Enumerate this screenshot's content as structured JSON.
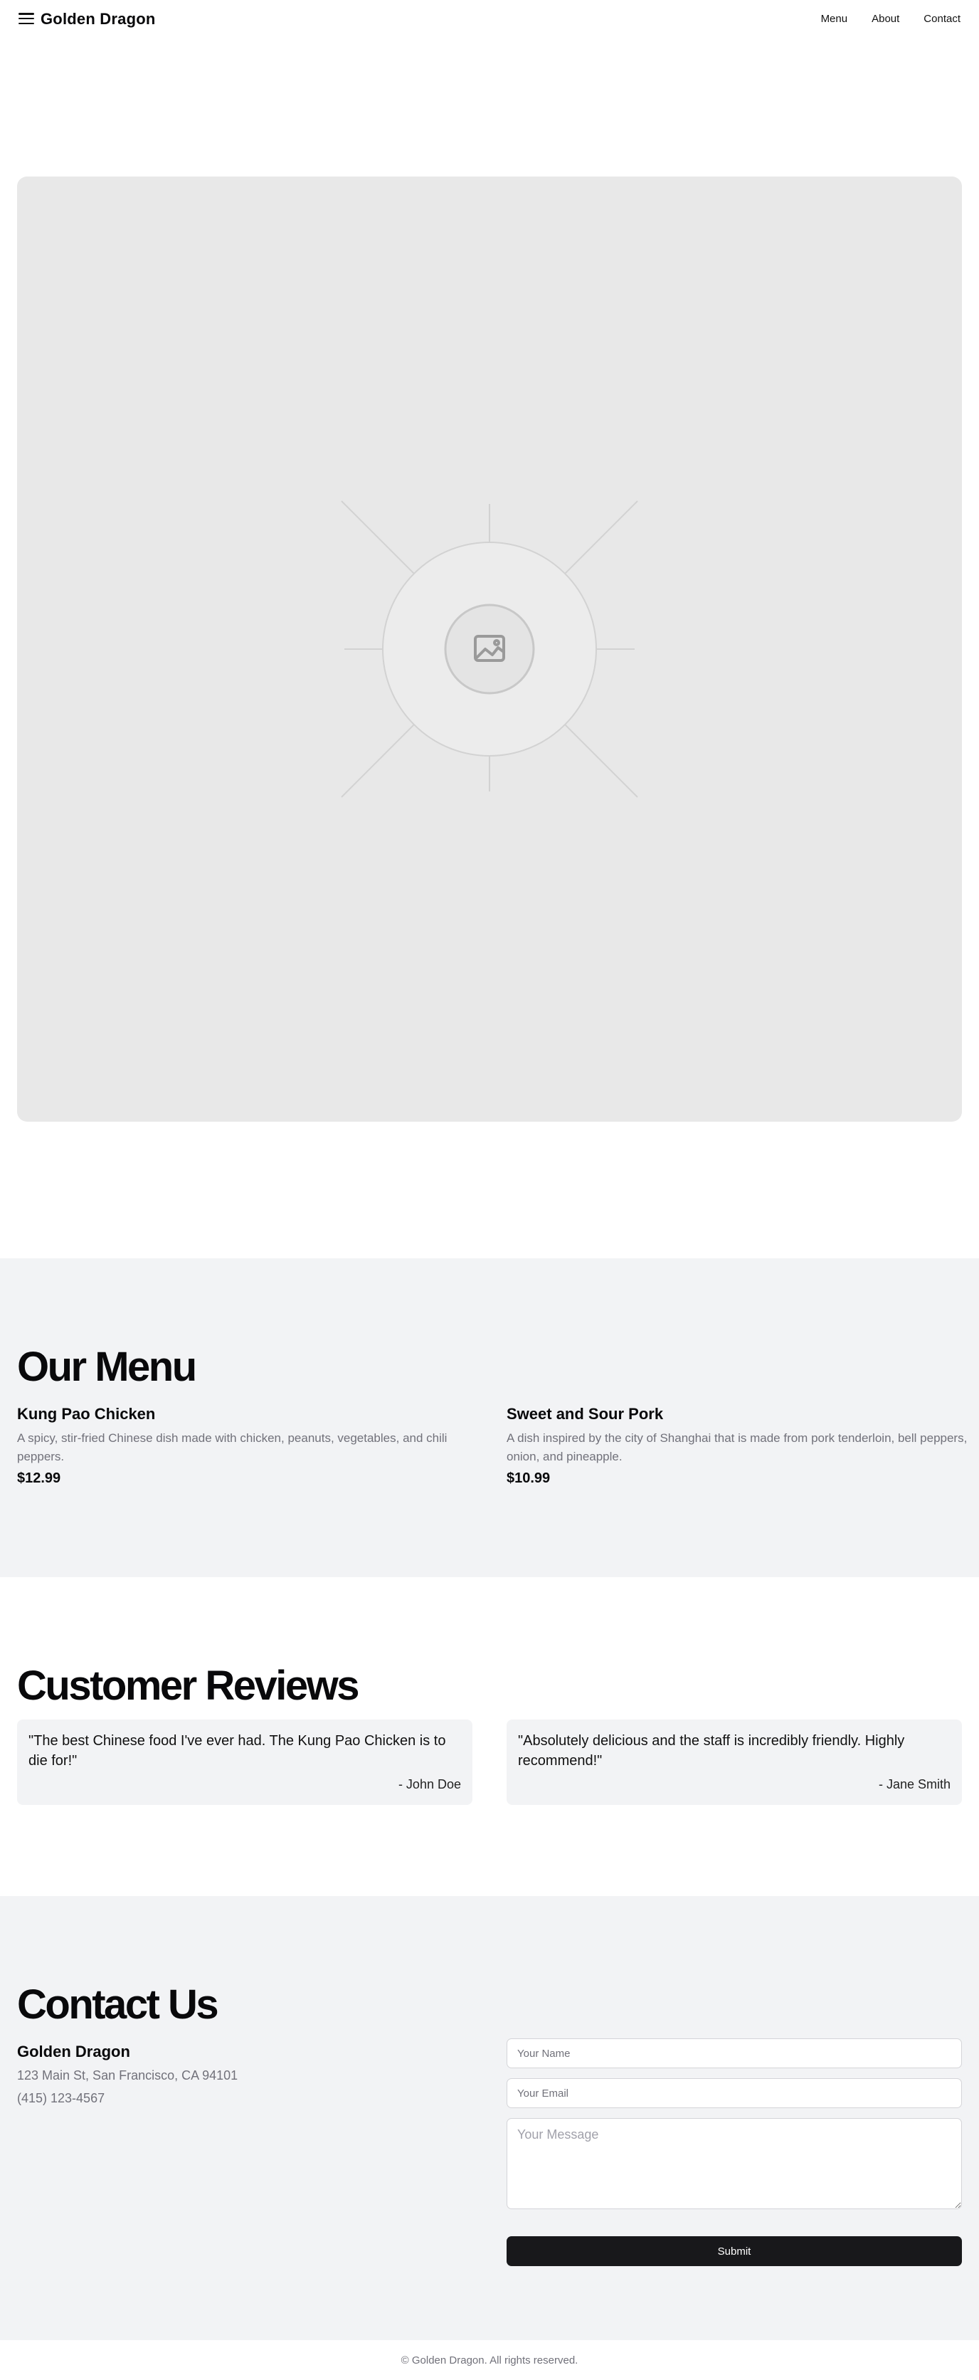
{
  "header": {
    "brand": "Golden Dragon",
    "nav": [
      "Menu",
      "About",
      "Contact"
    ]
  },
  "hero": {
    "image_icon": "image-placeholder-icon"
  },
  "menu_section": {
    "title": "Our Menu",
    "items": [
      {
        "name": "Kung Pao Chicken",
        "description": "A spicy, stir-fried Chinese dish made with chicken, peanuts, vegetables, and chili peppers.",
        "price": "$12.99"
      },
      {
        "name": "Sweet and Sour Pork",
        "description": "A dish inspired by the city of Shanghai that is made from pork tenderloin, bell peppers, onion, and pineapple.",
        "price": "$10.99"
      }
    ]
  },
  "reviews_section": {
    "title": "Customer Reviews",
    "reviews": [
      {
        "text": "\"The best Chinese food I've ever had. The Kung Pao Chicken is to die for!\"",
        "author": "- John Doe"
      },
      {
        "text": "\"Absolutely delicious and the staff is incredibly friendly. Highly recommend!\"",
        "author": "- Jane Smith"
      }
    ]
  },
  "contact_section": {
    "title": "Contact Us",
    "name": "Golden Dragon",
    "address": "123 Main St, San Francisco, CA 94101",
    "phone": "(415) 123-4567",
    "form": {
      "name_placeholder": "Your Name",
      "email_placeholder": "Your Email",
      "message_placeholder": "Your Message",
      "submit_label": "Submit"
    }
  },
  "footer": {
    "text": "© Golden Dragon. All rights reserved."
  },
  "colors": {
    "section_bg": "#f2f3f5",
    "button_bg": "#18181b",
    "muted_text": "#71717a"
  }
}
